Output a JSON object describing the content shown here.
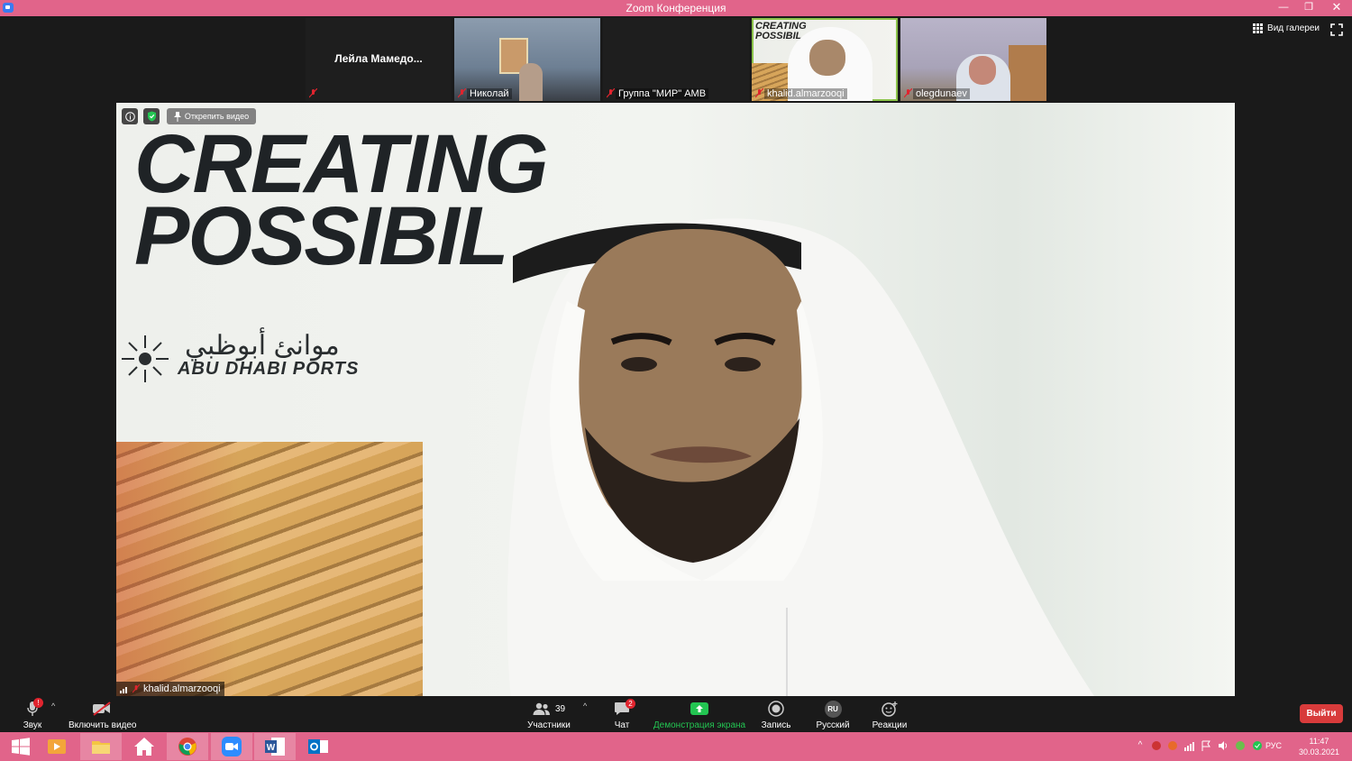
{
  "window": {
    "title": "Zoom Конференция",
    "minimize": "—",
    "restore": "❐",
    "close": "✕"
  },
  "thumbnails": [
    {
      "name": "Лейла  Мамедо..."
    },
    {
      "name": "Николай"
    },
    {
      "name": "Группа \"МИР\" АМВ"
    },
    {
      "name": "khalid.almarzooqi",
      "overlay1": "CREATING",
      "overlay2": "POSSIBIL"
    },
    {
      "name": "olegdunaev"
    }
  ],
  "gallery_view_label": "Вид галереи",
  "main_video": {
    "unpin_label": "Открепить видео",
    "participant_name": "khalid.almarzooqi",
    "banner_line1": "CREATING",
    "banner_line2": "POSSIBIL",
    "logo_arabic": "موانئ أبوظبي",
    "logo_english": "ABU DHABI PORTS"
  },
  "toolbar": {
    "audio_label": "Звук",
    "video_label": "Включить видео",
    "participants_label": "Участники",
    "participants_count": "39",
    "chat_label": "Чат",
    "chat_badge": "2",
    "share_label": "Демонстрация экрана",
    "record_label": "Запись",
    "language_label": "Русский",
    "language_code": "RU",
    "reactions_label": "Реакции",
    "leave_label": "Выйти",
    "audio_badge": "!"
  },
  "taskbar": {
    "lang": "РУС",
    "time": "11:47",
    "date": "30.03.2021"
  },
  "colors": {
    "accent": "#e1648a",
    "share_green": "#23c552",
    "leave_red": "#d83b3b"
  }
}
